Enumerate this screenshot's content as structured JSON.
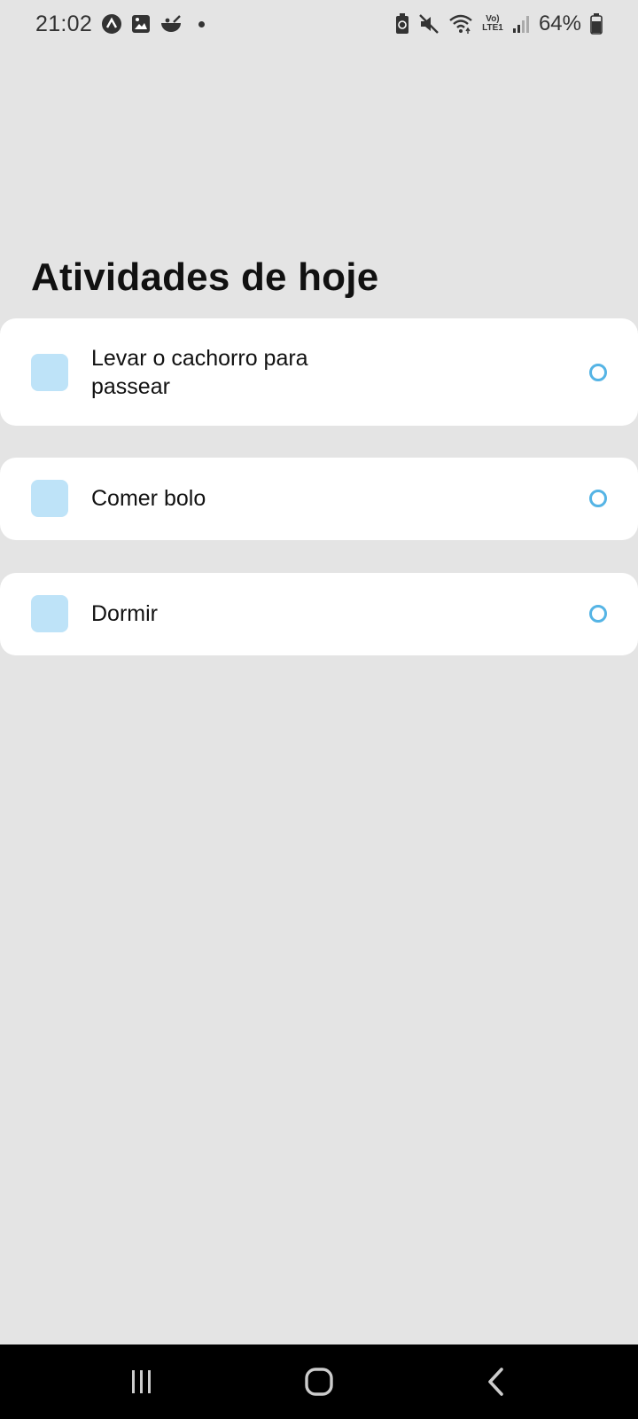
{
  "status_bar": {
    "time": "21:02",
    "battery_percent": "64%",
    "network_label": "Vo) LTE1",
    "icons_left": [
      "app-notification-icon",
      "gallery-icon",
      "bowl-icon",
      "dot"
    ],
    "icons_right": [
      "battery-saver-icon",
      "mute-icon",
      "wifi-icon",
      "volte-icon",
      "signal-icon",
      "battery-icon"
    ]
  },
  "page": {
    "title": "Atividades de hoje"
  },
  "tasks": [
    {
      "text": "Levar o cachorro para passear",
      "done": false
    },
    {
      "text": "Comer bolo",
      "done": false
    },
    {
      "text": "Dormir",
      "done": false
    }
  ],
  "colors": {
    "background": "#e4e4e4",
    "card": "#ffffff",
    "square": "#bee3f8",
    "circle_border": "#55b4e5",
    "nav_bar": "#000000"
  },
  "nav_bar": {
    "buttons": [
      "recents-icon",
      "home-icon",
      "back-icon"
    ]
  }
}
